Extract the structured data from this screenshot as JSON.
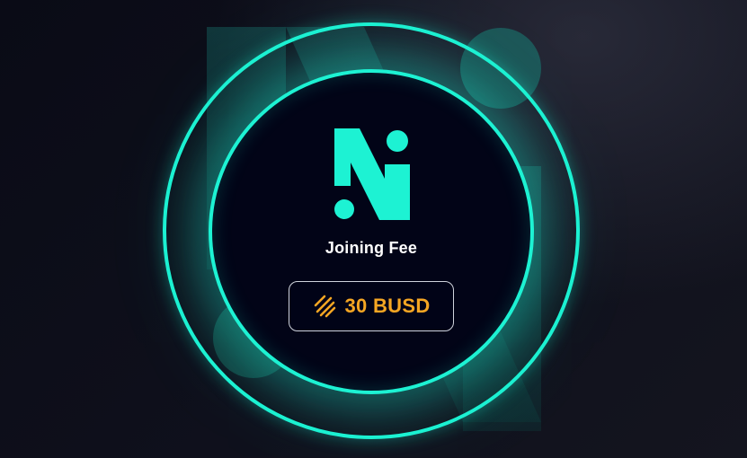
{
  "fee": {
    "label": "Joining Fee",
    "amount": "30 BUSD",
    "token_icon": "busd-icon"
  },
  "colors": {
    "accent": "#1df2d3",
    "amount": "#f5a623",
    "background": "#0b0c17",
    "disc": "#020417"
  },
  "icons": {
    "logo": "n-logo",
    "token": "busd-icon"
  }
}
